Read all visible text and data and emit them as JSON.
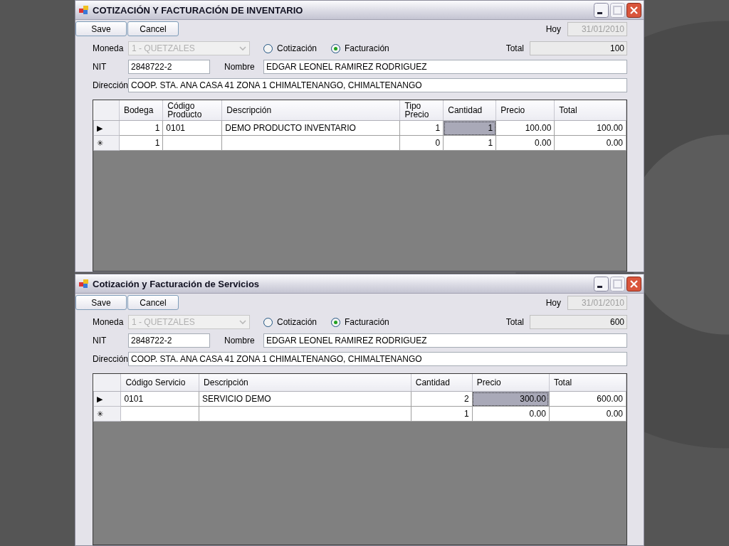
{
  "windows": [
    {
      "title": "COTIZACIÓN Y FACTURACIÓN DE INVENTARIO",
      "buttons": [
        "Save",
        "Cancel"
      ],
      "date_label": "Hoy",
      "date": "31/01/2010",
      "moneda_label": "Moneda",
      "moneda": "1 - QUETZALES",
      "radios": [
        {
          "label": "Cotización",
          "selected": false
        },
        {
          "label": "Facturación",
          "selected": true
        }
      ],
      "total_label": "Total",
      "total": "100",
      "nit_label": "NIT",
      "nit": "2848722-2",
      "nombre_label": "Nombre",
      "nombre": "EDGAR LEONEL RAMIREZ RODRIGUEZ",
      "direccion_label": "Dirección",
      "direccion": "COOP. STA. ANA CASA 41 ZONA 1 CHIMALTENANGO, CHIMALTENANGO",
      "table": {
        "columns": [
          {
            "label": "Bodega",
            "kind": "number"
          },
          {
            "label": "Código Producto",
            "kind": "text"
          },
          {
            "label": "Descripción",
            "kind": "text"
          },
          {
            "label": "Tipo Precio",
            "kind": "number"
          },
          {
            "label": "Cantidad",
            "kind": "number"
          },
          {
            "label": "Precio",
            "kind": "number"
          },
          {
            "label": "Total",
            "kind": "number"
          }
        ],
        "rows": [
          {
            "marker": "▶",
            "cells": [
              {
                "text": "1",
                "selected": false
              },
              {
                "text": "0101",
                "selected": false
              },
              {
                "text": "DEMO PRODUCTO INVENTARIO",
                "selected": false
              },
              {
                "text": "1",
                "selected": false
              },
              {
                "text": "1",
                "selected": true
              },
              {
                "text": "100.00",
                "selected": false
              },
              {
                "text": "100.00",
                "selected": false
              }
            ]
          },
          {
            "marker": "✳",
            "cells": [
              {
                "text": "1",
                "selected": false
              },
              {
                "text": "",
                "selected": false
              },
              {
                "text": "",
                "selected": false
              },
              {
                "text": "0",
                "selected": false
              },
              {
                "text": "1",
                "selected": false
              },
              {
                "text": "0.00",
                "selected": false
              },
              {
                "text": "0.00",
                "selected": false
              }
            ]
          }
        ]
      }
    },
    {
      "title": "Cotización y Facturación de Servicios",
      "buttons": [
        "Save",
        "Cancel"
      ],
      "date_label": "Hoy",
      "date": "31/01/2010",
      "moneda_label": "Moneda",
      "moneda": "1 - QUETZALES",
      "radios": [
        {
          "label": "Cotización",
          "selected": false
        },
        {
          "label": "Facturación",
          "selected": true
        }
      ],
      "total_label": "Total",
      "total": "600",
      "nit_label": "NIT",
      "nit": "2848722-2",
      "nombre_label": "Nombre",
      "nombre": "EDGAR LEONEL RAMIREZ RODRIGUEZ",
      "direccion_label": "Dirección",
      "direccion": "COOP. STA. ANA CASA 41 ZONA 1 CHIMALTENANGO, CHIMALTENANGO",
      "table": {
        "columns": [
          {
            "label": "Código Servicio",
            "kind": "text"
          },
          {
            "label": "Descripción",
            "kind": "text"
          },
          {
            "label": "Cantidad",
            "kind": "number"
          },
          {
            "label": "Precio",
            "kind": "number"
          },
          {
            "label": "Total",
            "kind": "number"
          }
        ],
        "rows": [
          {
            "marker": "▶",
            "cells": [
              {
                "text": "0101",
                "selected": false
              },
              {
                "text": "SERVICIO DEMO",
                "selected": false
              },
              {
                "text": "2",
                "selected": false
              },
              {
                "text": "300.00",
                "selected": true
              },
              {
                "text": "600.00",
                "selected": false
              }
            ]
          },
          {
            "marker": "✳",
            "cells": [
              {
                "text": "",
                "selected": false
              },
              {
                "text": "",
                "selected": false
              },
              {
                "text": "1",
                "selected": false
              },
              {
                "text": "0.00",
                "selected": false
              },
              {
                "text": "0.00",
                "selected": false
              }
            ]
          }
        ]
      }
    }
  ]
}
